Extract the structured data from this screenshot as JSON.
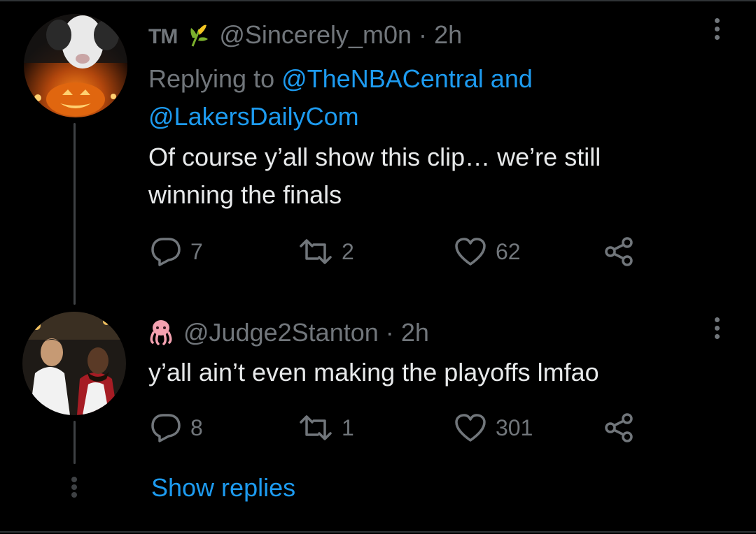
{
  "tweets": [
    {
      "display_name": "TM",
      "name_emoji": "corn-icon",
      "handle": "@Sincerely_m0n",
      "separator": "·",
      "time": "2h",
      "replying_prefix": "Replying to",
      "replying_to_1": "@TheNBACentral",
      "replying_and": "and",
      "replying_to_2": "@LakersDailyCom",
      "text_line1": "Of course y’all show this clip… we’re still",
      "text_line2": "winning the finals",
      "replies": "7",
      "retweets": "2",
      "likes": "62"
    },
    {
      "name_emoji": "octopus-icon",
      "handle": "@Judge2Stanton",
      "separator": "·",
      "time": "2h",
      "text_line1": "y’all ain’t even making the playoffs lmfao",
      "replies": "8",
      "retweets": "1",
      "likes": "301"
    }
  ],
  "show_replies_label": "Show replies",
  "colors": {
    "background": "#000000",
    "text": "#e7e9ea",
    "muted": "#71767b",
    "link": "#1d9bf0",
    "thread_line": "#3e4144"
  }
}
